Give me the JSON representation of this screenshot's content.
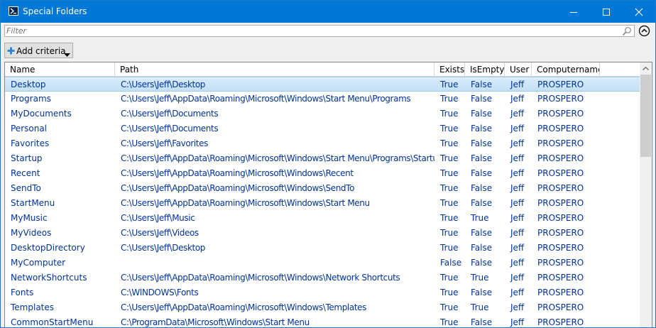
{
  "window": {
    "title": "Special Folders"
  },
  "filter": {
    "placeholder": "Filter"
  },
  "toolbar": {
    "add_criteria_label": "Add criteria"
  },
  "grid": {
    "columns": [
      "Name",
      "Path",
      "Exists",
      "IsEmpty",
      "User",
      "Computername"
    ],
    "rows": [
      {
        "name": "Desktop",
        "path": "C:\\Users\\Jeff\\Desktop",
        "exists": "True",
        "isempty": "False",
        "user": "Jeff",
        "computername": "PROSPERO"
      },
      {
        "name": "Programs",
        "path": "C:\\Users\\Jeff\\AppData\\Roaming\\Microsoft\\Windows\\Start Menu\\Programs",
        "exists": "True",
        "isempty": "False",
        "user": "Jeff",
        "computername": "PROSPERO"
      },
      {
        "name": "MyDocuments",
        "path": "C:\\Users\\Jeff\\Documents",
        "exists": "True",
        "isempty": "False",
        "user": "Jeff",
        "computername": "PROSPERO"
      },
      {
        "name": "Personal",
        "path": "C:\\Users\\Jeff\\Documents",
        "exists": "True",
        "isempty": "False",
        "user": "Jeff",
        "computername": "PROSPERO"
      },
      {
        "name": "Favorites",
        "path": "C:\\Users\\Jeff\\Favorites",
        "exists": "True",
        "isempty": "False",
        "user": "Jeff",
        "computername": "PROSPERO"
      },
      {
        "name": "Startup",
        "path": "C:\\Users\\Jeff\\AppData\\Roaming\\Microsoft\\Windows\\Start Menu\\Programs\\Startup",
        "exists": "True",
        "isempty": "False",
        "user": "Jeff",
        "computername": "PROSPERO"
      },
      {
        "name": "Recent",
        "path": "C:\\Users\\Jeff\\AppData\\Roaming\\Microsoft\\Windows\\Recent",
        "exists": "True",
        "isempty": "False",
        "user": "Jeff",
        "computername": "PROSPERO"
      },
      {
        "name": "SendTo",
        "path": "C:\\Users\\Jeff\\AppData\\Roaming\\Microsoft\\Windows\\SendTo",
        "exists": "True",
        "isempty": "False",
        "user": "Jeff",
        "computername": "PROSPERO"
      },
      {
        "name": "StartMenu",
        "path": "C:\\Users\\Jeff\\AppData\\Roaming\\Microsoft\\Windows\\Start Menu",
        "exists": "True",
        "isempty": "False",
        "user": "Jeff",
        "computername": "PROSPERO"
      },
      {
        "name": "MyMusic",
        "path": "C:\\Users\\Jeff\\Music",
        "exists": "True",
        "isempty": "True",
        "user": "Jeff",
        "computername": "PROSPERO"
      },
      {
        "name": "MyVideos",
        "path": "C:\\Users\\Jeff\\Videos",
        "exists": "True",
        "isempty": "False",
        "user": "Jeff",
        "computername": "PROSPERO"
      },
      {
        "name": "DesktopDirectory",
        "path": "C:\\Users\\Jeff\\Desktop",
        "exists": "True",
        "isempty": "False",
        "user": "Jeff",
        "computername": "PROSPERO"
      },
      {
        "name": "MyComputer",
        "path": "",
        "exists": "False",
        "isempty": "False",
        "user": "Jeff",
        "computername": "PROSPERO"
      },
      {
        "name": "NetworkShortcuts",
        "path": "C:\\Users\\Jeff\\AppData\\Roaming\\Microsoft\\Windows\\Network Shortcuts",
        "exists": "True",
        "isempty": "True",
        "user": "Jeff",
        "computername": "PROSPERO"
      },
      {
        "name": "Fonts",
        "path": "C:\\WINDOWS\\Fonts",
        "exists": "True",
        "isempty": "False",
        "user": "Jeff",
        "computername": "PROSPERO"
      },
      {
        "name": "Templates",
        "path": "C:\\Users\\Jeff\\AppData\\Roaming\\Microsoft\\Windows\\Templates",
        "exists": "True",
        "isempty": "True",
        "user": "Jeff",
        "computername": "PROSPERO"
      },
      {
        "name": "CommonStartMenu",
        "path": "C:\\ProgramData\\Microsoft\\Windows\\Start Menu",
        "exists": "True",
        "isempty": "False",
        "user": "Jeff",
        "computername": "PROSPERO"
      }
    ]
  },
  "colors": {
    "titlebar": "#0078d7",
    "cell_text": "#003399",
    "selected_row": "#c3e0f6"
  },
  "icons": [
    "powershell-icon",
    "minimize-icon",
    "maximize-icon",
    "close-icon",
    "search-icon",
    "collapse-up-icon",
    "plus-icon",
    "dropdown-arrow-icon",
    "scroll-up-arrow-icon"
  ]
}
